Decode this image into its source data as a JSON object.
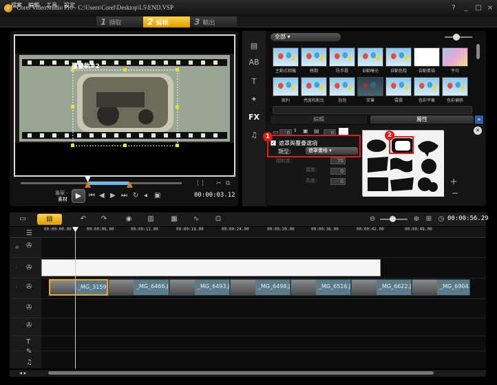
{
  "window": {
    "title": "Corel VideoStudio Pro - C:\\Users\\Corel\\Desktop\\L5\\END.VSP",
    "controls": [
      "?",
      "_",
      "□",
      "×"
    ]
  },
  "menu": [
    "檔案",
    "編輯",
    "工具",
    "設定"
  ],
  "workflow": [
    {
      "num": "1",
      "label": "擷取"
    },
    {
      "num": "2",
      "label": "編輯"
    },
    {
      "num": "3",
      "label": "輸出"
    }
  ],
  "preview": {
    "overlay_name": "覆疊軌#2",
    "mode_project": "專案 -",
    "mode_clip": "素材",
    "timecode": "00:00:03.12"
  },
  "library": {
    "folder": "全部",
    "tab_edit": "編輯",
    "tab_attribute": "屬性",
    "filters_row1": [
      "主動式相機",
      "晚期",
      "防手震",
      "自動曝光",
      "自動色階",
      "自動素描",
      "平均"
    ],
    "filters_row2": [
      "銳利",
      "亮度和對比",
      "泡泡",
      "炭筆",
      "雲霧",
      "色彩平衡",
      "色彩偏移"
    ]
  },
  "attributes": {
    "mask_checkbox_label": "遮罩與覆疊選項",
    "type_label": "類型:",
    "type_value": "遮罩畫格",
    "similarity_label": "相似度:",
    "width_label": "寬度:",
    "height_label": "高度:",
    "values": [
      "0",
      "0",
      "70",
      "0",
      "0"
    ],
    "callout1": "1",
    "callout2": "2"
  },
  "timeline": {
    "total_time": "00:00:56.29",
    "ruler": [
      "00:00:00.00",
      "00:00:06.00",
      "00:00:12.00",
      "00:00:18.00",
      "00:00:24.00",
      "00:00:30.00",
      "00:00:36.00",
      "00:00:42.00",
      "00:00:48.00"
    ],
    "clips": [
      "_MG_3159...",
      "_MG_6466.JPG",
      "_MG_6493.JPG",
      "_MG_6498.JPG",
      "_MG_6516.J...",
      "_MG_6622.JPG",
      "_MG_6904.JF"
    ]
  },
  "colors": {
    "accent": "#f0a81c",
    "highlight": "#e51b1b",
    "selection": "#6bb9e4"
  }
}
